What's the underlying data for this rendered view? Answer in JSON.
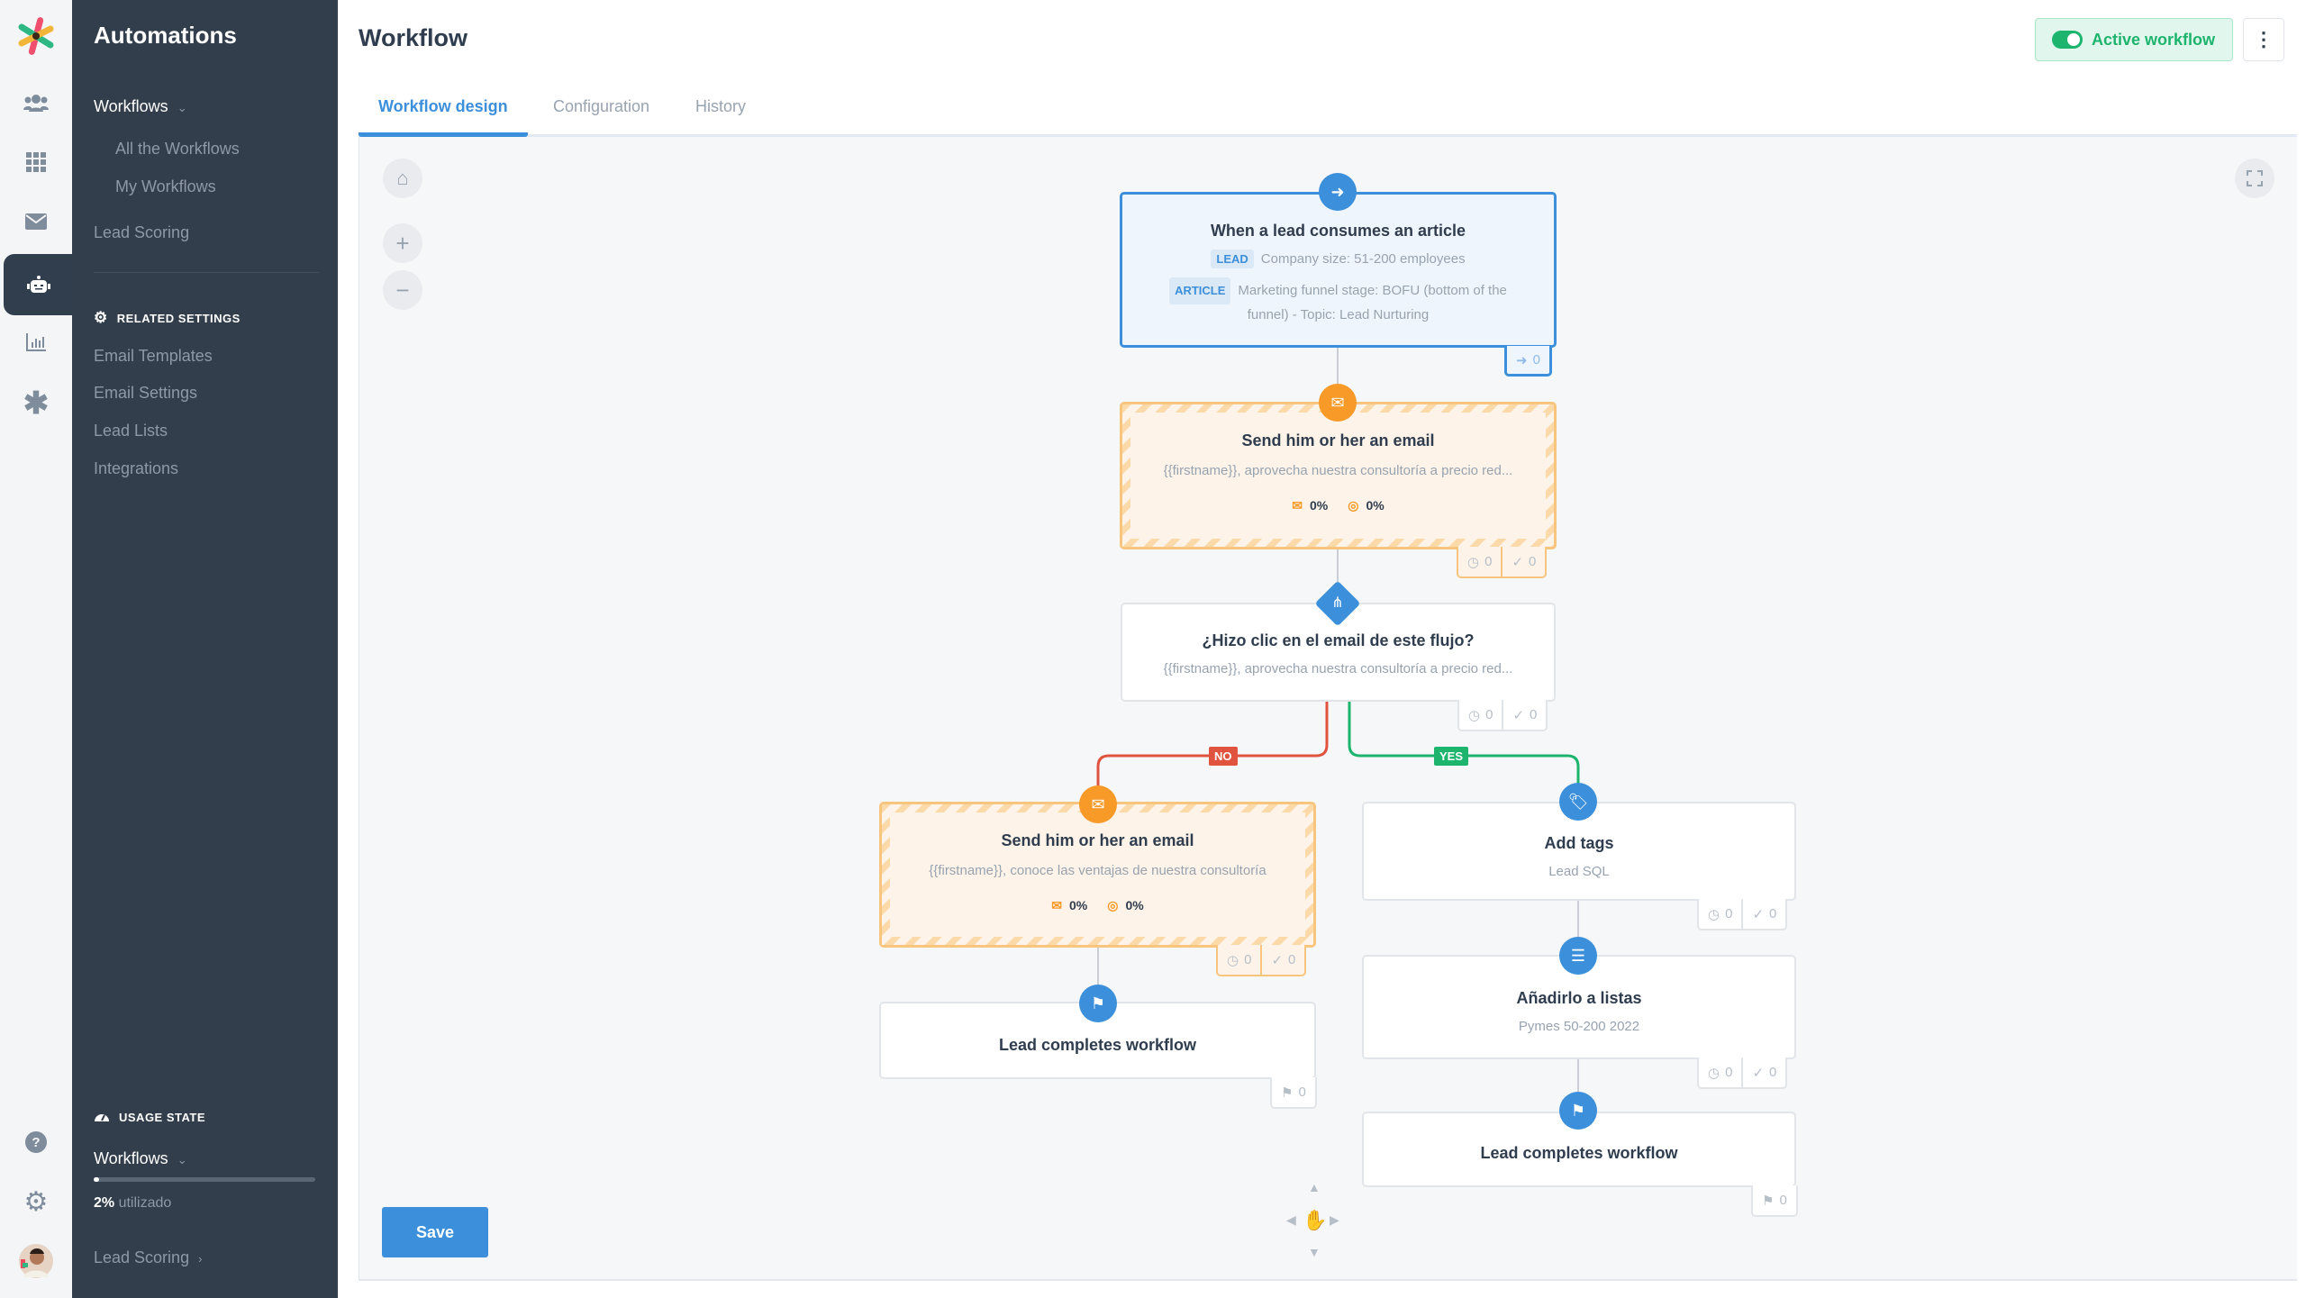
{
  "rail": {
    "items": [
      {
        "icon": "leads-icon"
      },
      {
        "icon": "apps-grid-icon"
      },
      {
        "icon": "email-icon"
      },
      {
        "icon": "robot-icon",
        "active": true
      },
      {
        "icon": "reports-icon"
      },
      {
        "icon": "asterisk-icon"
      }
    ],
    "bottom": [
      {
        "icon": "help-icon"
      },
      {
        "icon": "settings-icon"
      },
      {
        "icon": "avatar"
      }
    ]
  },
  "sidebar": {
    "title": "Automations",
    "workflows_label": "Workflows",
    "all_workflows": "All the Workflows",
    "my_workflows": "My Workflows",
    "lead_scoring": "Lead Scoring",
    "related_settings": "RELATED SETTINGS",
    "settings_links": [
      "Email Templates",
      "Email Settings",
      "Lead Lists",
      "Integrations"
    ],
    "usage_state": "USAGE STATE",
    "usage_selector": "Workflows",
    "usage_percent": 2,
    "usage_percent_label": "2%",
    "usage_suffix": "utilizado",
    "lead_scoring_bottom": "Lead Scoring"
  },
  "header": {
    "title": "Workflow",
    "active_label": "Active workflow",
    "active": true,
    "more_label": "⋮"
  },
  "tabs": [
    {
      "label": "Workflow design",
      "active": true
    },
    {
      "label": "Configuration",
      "active": false
    },
    {
      "label": "History",
      "active": false
    }
  ],
  "canvas": {
    "save_label": "Save",
    "nodes": {
      "trigger": {
        "title": "When a lead consumes an article",
        "lead_badge": "LEAD",
        "lead_text": "Company size: 51-200 employees",
        "article_badge": "ARTICLE",
        "article_text": "Marketing funnel stage: BOFU (bottom of the funnel) - Topic: Lead Nurturing",
        "entered": "0"
      },
      "email1": {
        "title": "Send him or her an email",
        "subtitle": "{{firstname}}, aprovecha nuestra consultoría a precio red...",
        "open_rate": "0%",
        "click_rate": "0%",
        "waiting": "0",
        "done": "0"
      },
      "condition": {
        "title": "¿Hizo clic en el email de este flujo?",
        "subtitle": "{{firstname}}, aprovecha nuestra consultoría a precio red...",
        "waiting": "0",
        "done": "0",
        "no_label": "NO",
        "yes_label": "YES"
      },
      "email2": {
        "title": "Send him or her an email",
        "subtitle": "{{firstname}}, conoce las ventajas de nuestra consultoría",
        "open_rate": "0%",
        "click_rate": "0%",
        "waiting": "0",
        "done": "0"
      },
      "complete_left": {
        "title": "Lead completes workflow",
        "completed": "0"
      },
      "tags": {
        "title": "Add tags",
        "subtitle": "Lead SQL",
        "waiting": "0",
        "done": "0"
      },
      "lists": {
        "title": "Añadirlo a listas",
        "subtitle": "Pymes 50-200 2022",
        "waiting": "0",
        "done": "0"
      },
      "complete_right": {
        "title": "Lead completes workflow",
        "completed": "0"
      }
    }
  },
  "colors": {
    "accent": "#3b8fdb",
    "email": "#f79a28",
    "no": "#e0533f",
    "yes": "#1db56e",
    "sidebar": "#323e4c"
  }
}
